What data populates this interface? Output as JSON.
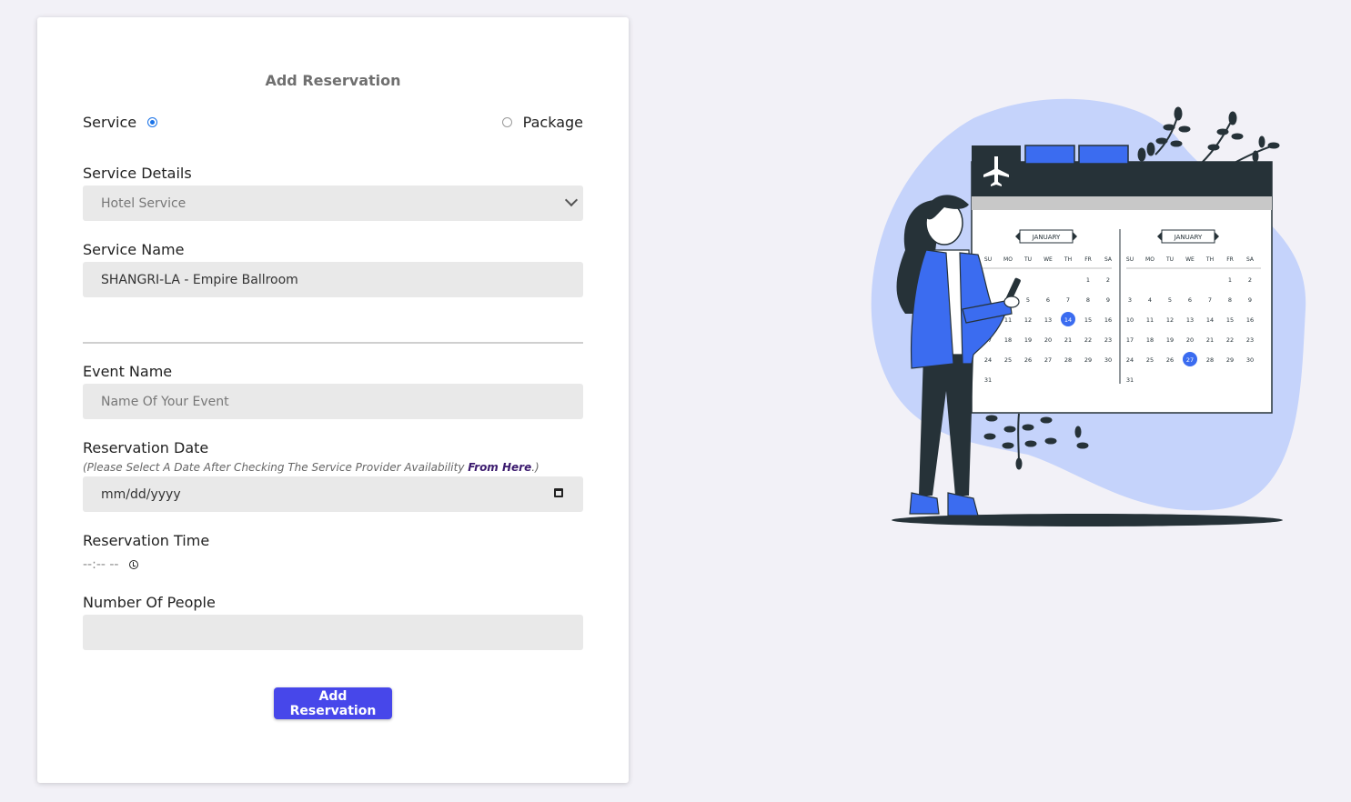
{
  "form": {
    "title": "Add Reservation",
    "radio_service_label": "Service",
    "radio_package_label": "Package",
    "service_details_label": "Service Details",
    "service_details_value": "Hotel Service",
    "service_name_label": "Service Name",
    "service_name_value": "SHANGRI-LA - Empire Ballroom",
    "event_name_label": "Event Name",
    "event_name_placeholder": "Name Of Your Event",
    "reservation_date_label": "Reservation Date",
    "hint_prefix": "(Please Select A Date After Checking The Service Provider Availability ",
    "hint_link": "From Here",
    "hint_suffix": ".)",
    "date_placeholder": "mm/dd/yyyy",
    "reservation_time_label": "Reservation Time",
    "time_placeholder": "--:-- --",
    "number_of_people_label": "Number Of People",
    "submit_label": "Add Reservation"
  },
  "illustration": {
    "month_label": "JANUARY",
    "weekdays": [
      "SU",
      "MO",
      "TU",
      "WE",
      "TH",
      "FR",
      "SA"
    ],
    "left_days": [
      "1",
      "2",
      "3",
      "4",
      "5",
      "6",
      "7",
      "8",
      "9",
      "10",
      "11",
      "12",
      "13",
      "14",
      "15",
      "16",
      "17",
      "18",
      "19",
      "20",
      "21",
      "22",
      "23",
      "24",
      "25",
      "26",
      "27",
      "28",
      "29",
      "30",
      "31"
    ],
    "right_days": [
      "1",
      "2",
      "3",
      "4",
      "5",
      "6",
      "7",
      "8",
      "9",
      "10",
      "11",
      "12",
      "13",
      "14",
      "15",
      "16",
      "17",
      "18",
      "19",
      "20",
      "21",
      "22",
      "23",
      "24",
      "25",
      "26",
      "27",
      "28",
      "29",
      "30",
      "31"
    ],
    "left_highlight": "14",
    "right_highlight": "27",
    "colors": {
      "blob": "#c5d3fb",
      "accent": "#3b6cf0",
      "dark": "#263238"
    }
  }
}
